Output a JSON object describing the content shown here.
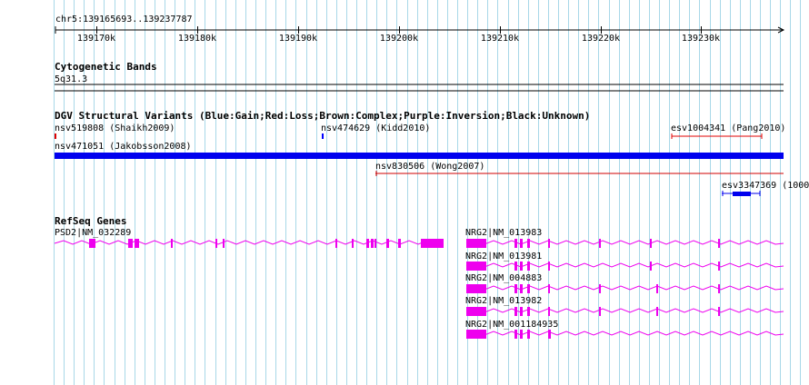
{
  "ruler": {
    "region": "chr5:139165693..139237787",
    "tick_labels": [
      "139170k",
      "139180k",
      "139190k",
      "139200k",
      "139210k",
      "139220k",
      "139230k"
    ]
  },
  "cytogenetic": {
    "title": "Cytogenetic Bands",
    "band": "5q31.3"
  },
  "dgv": {
    "title": "DGV Structural Variants (Blue:Gain;Red:Loss;Brown:Complex;Purple:Inversion;Black:Unknown)",
    "variants": [
      {
        "label": "nsv519808 (Shaikh2009)",
        "type": "loss",
        "color": "#e00000"
      },
      {
        "label": "nsv474629 (Kidd2010)",
        "type": "gain",
        "color": "#0000ff"
      },
      {
        "label": "esv1004341 (Pang2010)",
        "type": "loss",
        "color": "#e00000"
      },
      {
        "label": "nsv471051 (Jakobsson2008)",
        "type": "gain",
        "color": "#0000ee"
      },
      {
        "label": "nsv830506 (Wong2007)",
        "type": "loss",
        "color": "#d00000"
      },
      {
        "label": "esv3347369 (1000",
        "type": "gain",
        "color": "#0000ee"
      }
    ]
  },
  "refseq": {
    "title": "RefSeq Genes",
    "color": "#ee00ee",
    "genes": [
      {
        "label": "PSD2|NM_032289"
      },
      {
        "label": "NRG2|NM_013983"
      },
      {
        "label": "NRG2|NM_013981"
      },
      {
        "label": "NRG2|NM_004883"
      },
      {
        "label": "NRG2|NM_013982"
      },
      {
        "label": "NRG2|NM_001184935"
      }
    ]
  }
}
